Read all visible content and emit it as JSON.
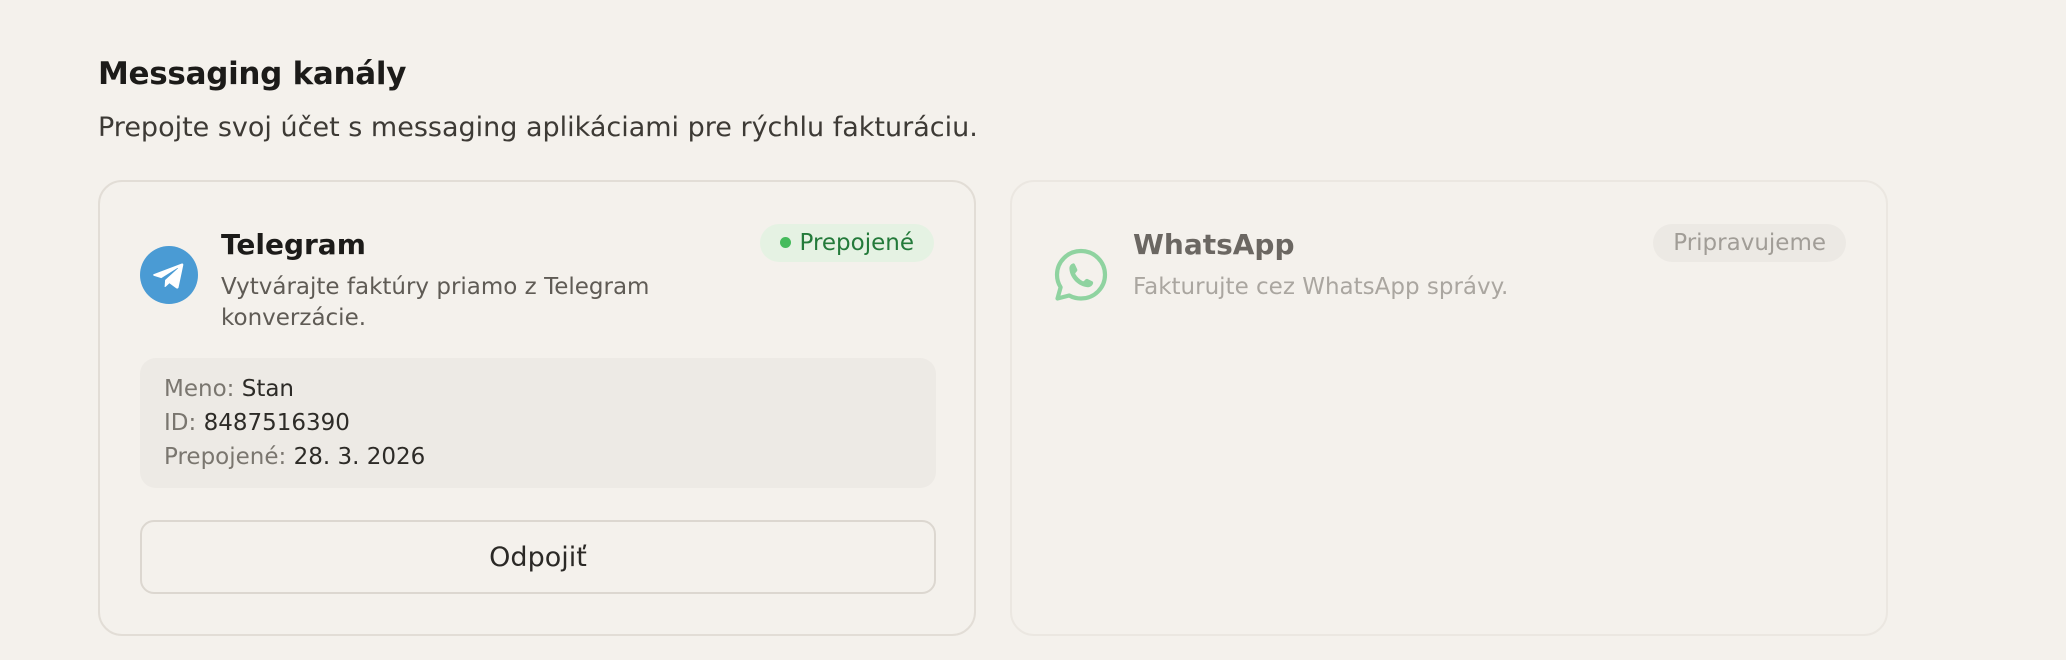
{
  "section": {
    "title": "Messaging kanály",
    "description": "Prepojte svoj účet s messaging aplikáciami pre rýchlu fakturáciu."
  },
  "telegram": {
    "name": "Telegram",
    "description": "Vytvárajte faktúry priamo z Telegram konverzácie.",
    "status": "Prepojené",
    "icon": "telegram-icon",
    "brand_color": "#4a9bd4",
    "info": {
      "name_label": "Meno:",
      "name_value": "Stan",
      "id_label": "ID:",
      "id_value": "8487516390",
      "connected_label": "Prepojené:",
      "connected_value": "28. 3. 2026"
    },
    "disconnect_label": "Odpojiť"
  },
  "whatsapp": {
    "name": "WhatsApp",
    "description": "Fakturujte cez WhatsApp správy.",
    "status": "Pripravujeme",
    "icon": "whatsapp-icon",
    "brand_color": "#8fd3a0"
  },
  "colors": {
    "background": "#f4f1ec",
    "connected_badge_bg": "#e5f2e3",
    "connected_badge_text": "#237a3a",
    "connected_dot": "#45bb5c"
  }
}
